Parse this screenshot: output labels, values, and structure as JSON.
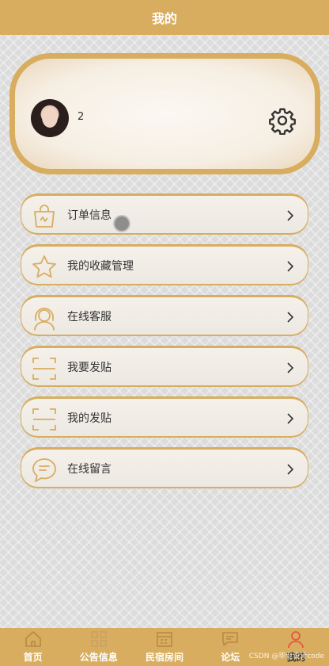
{
  "header": {
    "title": "我的"
  },
  "profile": {
    "username": "2"
  },
  "menu": [
    {
      "label": "订单信息",
      "icon": "bag-icon"
    },
    {
      "label": "我的收藏管理",
      "icon": "star-icon"
    },
    {
      "label": "在线客服",
      "icon": "support-agent-icon"
    },
    {
      "label": "我要发贴",
      "icon": "scan-frame-icon"
    },
    {
      "label": "我的发贴",
      "icon": "scan-frame-icon"
    },
    {
      "label": "在线留言",
      "icon": "chat-bubble-icon"
    }
  ],
  "tabbar": [
    {
      "label": "首页",
      "icon": "home-icon",
      "active": false
    },
    {
      "label": "公告信息",
      "icon": "grid-icon",
      "active": false
    },
    {
      "label": "民宿房间",
      "icon": "calendar-icon",
      "active": false
    },
    {
      "label": "论坛",
      "icon": "chat-icon",
      "active": false
    },
    {
      "label": "我的",
      "icon": "person-icon",
      "active": true
    }
  ],
  "watermark": "CSDN @毕业设计code",
  "colors": {
    "accent": "#d8ad5f",
    "active_tab": "#e8553f"
  }
}
